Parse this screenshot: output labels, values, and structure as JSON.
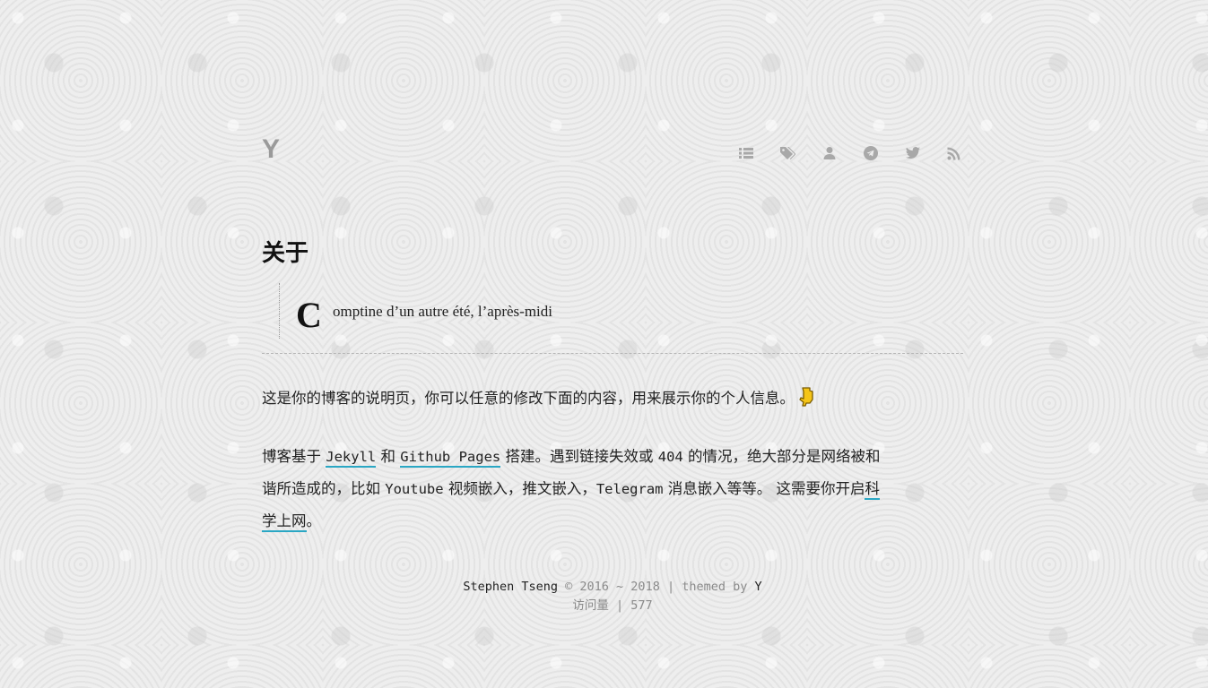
{
  "header": {
    "logo": "Y",
    "nav_icons": [
      "list-icon",
      "tags-icon",
      "user-icon",
      "telegram-icon",
      "twitter-icon",
      "rss-icon"
    ]
  },
  "main": {
    "title": "关于",
    "quote_dropcap": "C",
    "quote_rest": "omptine d’un autre été, l’après-midi",
    "para1": "这是你的博客的说明页，你可以任意的修改下面的内容，用来展示你的个人信息。",
    "para2": {
      "t1": "博客基于 ",
      "jekyll": "Jekyll",
      "t2": " 和 ",
      "github_pages": "Github Pages",
      "t3": " 搭建。遇到链接失效或 ",
      "code404": "404",
      "t4": " 的情况，绝大部分是网络被和",
      "t5": "谐所造成的，比如 ",
      "youtube": "Youtube",
      "t6": " 视频嵌入，推文嵌入，",
      "telegram": "Telegram",
      "t7": " 消息嵌入等等。 这需要你开启",
      "link_a": "科",
      "link_b": "学上网",
      "t8": "。"
    }
  },
  "footer": {
    "owner": "Stephen Tseng",
    "copyright": " © 2016 ~ 2018 | themed by ",
    "theme": "Y",
    "visits_label": "访问量 | ",
    "visits_count": "577"
  },
  "colors": {
    "link_underline": "#2aa7c4",
    "nav_icon": "#a8a8a8",
    "hand_icon": "#f5c518"
  }
}
